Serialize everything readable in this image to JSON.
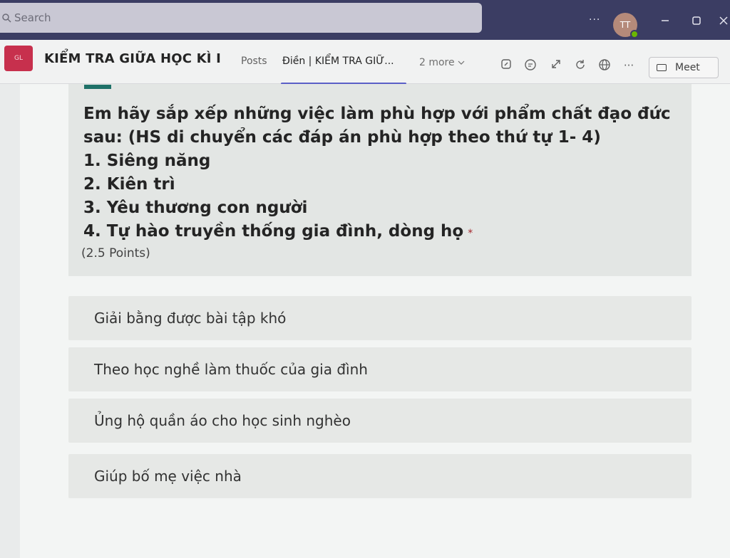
{
  "titlebar": {
    "search_placeholder": "Search",
    "more_label": "···",
    "avatar_initials": "TT"
  },
  "header": {
    "team_tile": "GL",
    "title": "KIỂM TRA GIỮA HỌC KÌ I",
    "tabs": [
      {
        "label": "Posts"
      },
      {
        "label": "Điền |  KIỂM TRA GIỮ..."
      }
    ],
    "more_tabs": "2 more",
    "more_actions": "···",
    "meet_label": "Meet"
  },
  "question": {
    "lines": [
      "Em hãy sắp xếp những việc làm phù hợp với phẩm chất đạo đức",
      "sau: (HS di chuyển các đáp án phù hợp theo thứ tự 1- 4)",
      "1. Siêng năng",
      "2. Kiên trì",
      "3. Yêu thương con người",
      "4. Tự hào truyền thống gia đình, dòng họ"
    ],
    "required_mark": "*",
    "points": "(2.5 Points)"
  },
  "options": [
    {
      "label": "Giải bằng được bài tập khó"
    },
    {
      "label": "Theo học nghề làm thuốc của gia đình"
    },
    {
      "label": "Ủng hộ quần áo cho học sinh nghèo"
    },
    {
      "label": "Giúp bố mẹ việc nhà"
    }
  ]
}
